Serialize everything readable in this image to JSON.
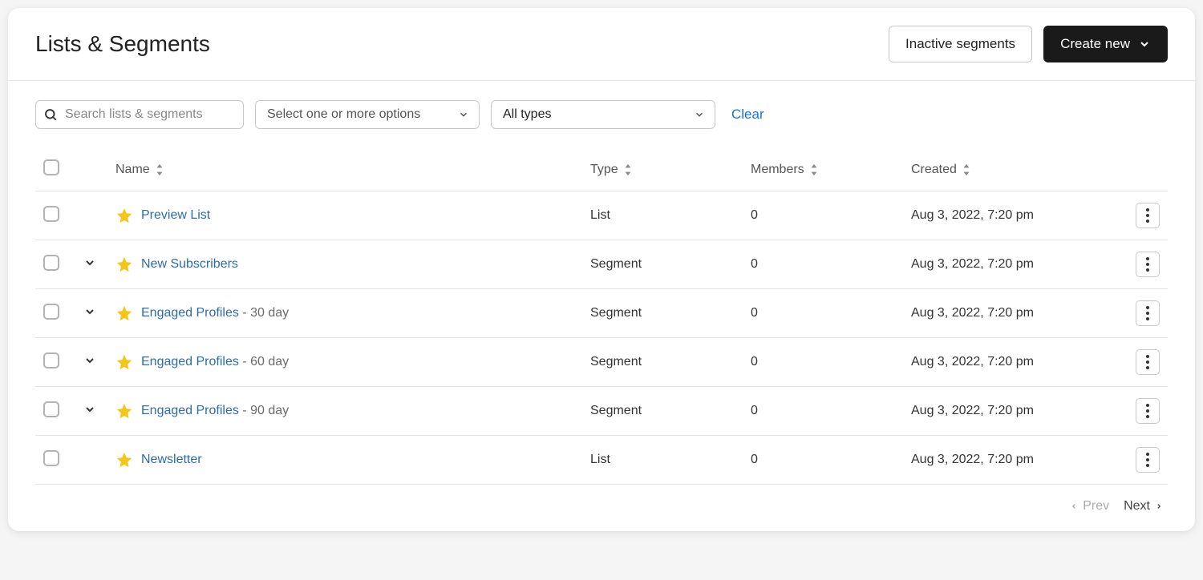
{
  "header": {
    "title": "Lists & Segments",
    "inactive_button": "Inactive segments",
    "create_button": "Create new"
  },
  "filters": {
    "search_placeholder": "Search lists & segments",
    "tags_placeholder": "Select one or more options",
    "types_value": "All types",
    "clear_label": "Clear"
  },
  "columns": {
    "name": "Name",
    "type": "Type",
    "members": "Members",
    "created": "Created"
  },
  "rows": [
    {
      "name": "Preview List",
      "suffix": "",
      "type": "List",
      "members": "0",
      "created": "Aug 3, 2022, 7:20 pm",
      "expandable": false
    },
    {
      "name": "New Subscribers",
      "suffix": "",
      "type": "Segment",
      "members": "0",
      "created": "Aug 3, 2022, 7:20 pm",
      "expandable": true
    },
    {
      "name": "Engaged Profiles",
      "suffix": " - 30 day",
      "type": "Segment",
      "members": "0",
      "created": "Aug 3, 2022, 7:20 pm",
      "expandable": true
    },
    {
      "name": "Engaged Profiles",
      "suffix": " - 60 day",
      "type": "Segment",
      "members": "0",
      "created": "Aug 3, 2022, 7:20 pm",
      "expandable": true
    },
    {
      "name": "Engaged Profiles",
      "suffix": " - 90 day",
      "type": "Segment",
      "members": "0",
      "created": "Aug 3, 2022, 7:20 pm",
      "expandable": true
    },
    {
      "name": "Newsletter",
      "suffix": "",
      "type": "List",
      "members": "0",
      "created": "Aug 3, 2022, 7:20 pm",
      "expandable": false
    }
  ],
  "pager": {
    "prev": "Prev",
    "next": "Next"
  }
}
